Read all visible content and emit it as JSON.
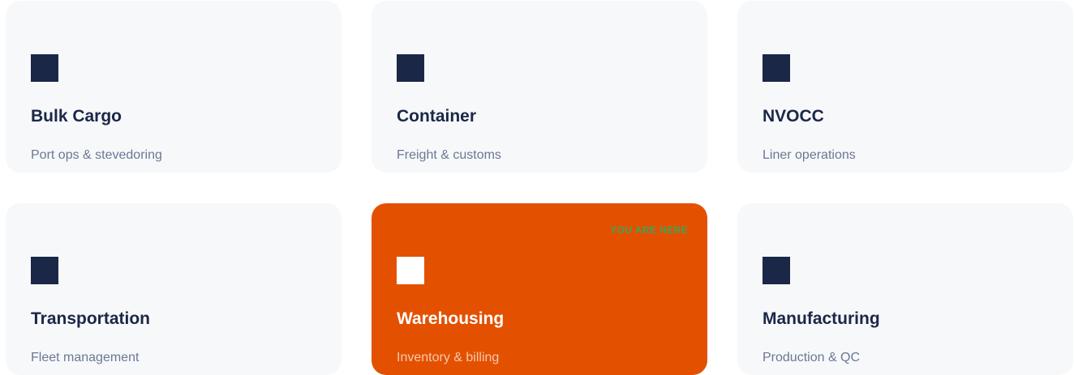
{
  "cards": [
    {
      "title": "Bulk Cargo",
      "subtitle": "Port ops & stevedoring",
      "icon": "square-icon"
    },
    {
      "title": "Container",
      "subtitle": "Freight & customs",
      "icon": "square-icon"
    },
    {
      "title": "NVOCC",
      "subtitle": "Liner operations",
      "icon": "square-icon"
    },
    {
      "title": "Transportation",
      "subtitle": "Fleet management",
      "icon": "square-icon"
    },
    {
      "title": "Warehousing",
      "subtitle": "Inventory & billing",
      "icon": "square-icon",
      "badge": "YOU ARE HERE",
      "active": true
    },
    {
      "title": "Manufacturing",
      "subtitle": "Production & QC",
      "icon": "square-icon"
    }
  ],
  "colors": {
    "card_bg": "#f7f8fa",
    "icon": "#1a2747",
    "title": "#1a2747",
    "subtitle": "#6b7893",
    "active_bg": "#e35100",
    "badge": "#3fa35a"
  }
}
